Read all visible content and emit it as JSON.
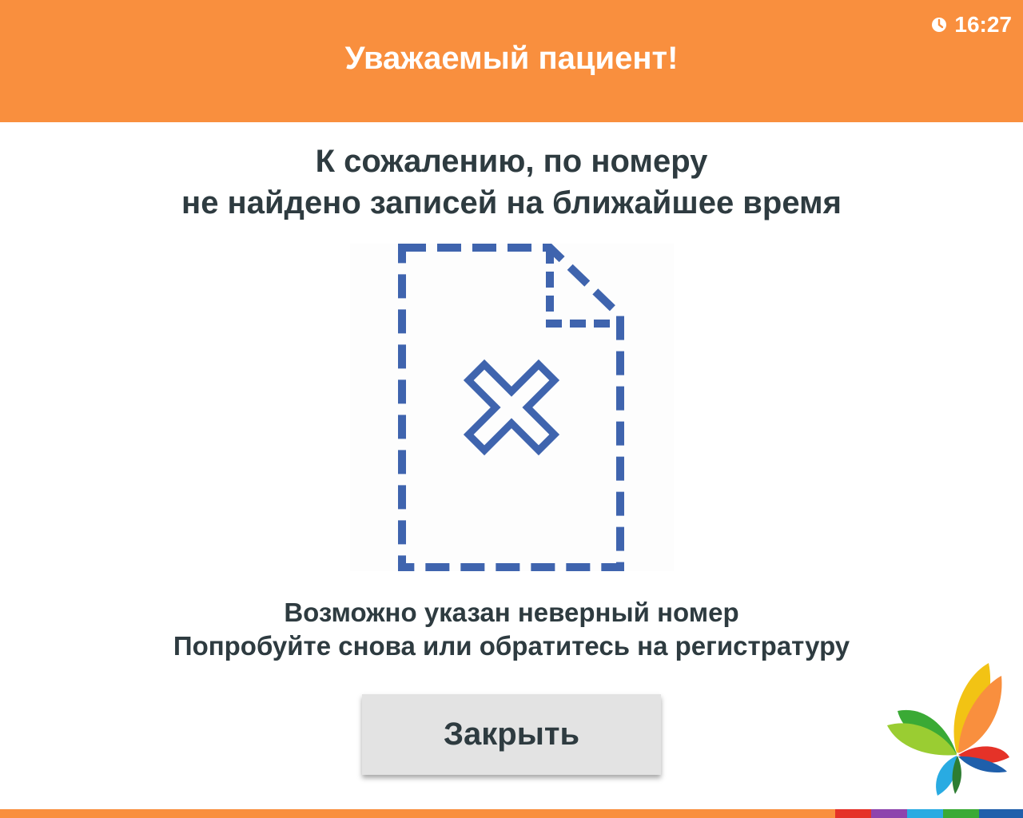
{
  "header": {
    "title": "Уважаемый пациент!",
    "time": "16:27",
    "background_color": "#f98f3e",
    "clock_icon": "clock-icon"
  },
  "main": {
    "headline_line1": "К сожалению, по номеру",
    "headline_line2": "не найдено записей на ближайшее время",
    "illustration_icon": "document-not-found-icon",
    "illustration_color": "#3f64ae",
    "message_line1": "Возможно указан неверный номер",
    "message_line2": "Попробуйте снова или обратитесь на регистратуру"
  },
  "actions": {
    "close_label": "Закрыть"
  },
  "branding": {
    "logo_icon": "butterfly-logo-icon",
    "bottom_bar_colors": [
      "#f98f3e",
      "#e53228",
      "#8e44ad",
      "#29abe2",
      "#3aaa35",
      "#1f5fab"
    ]
  }
}
